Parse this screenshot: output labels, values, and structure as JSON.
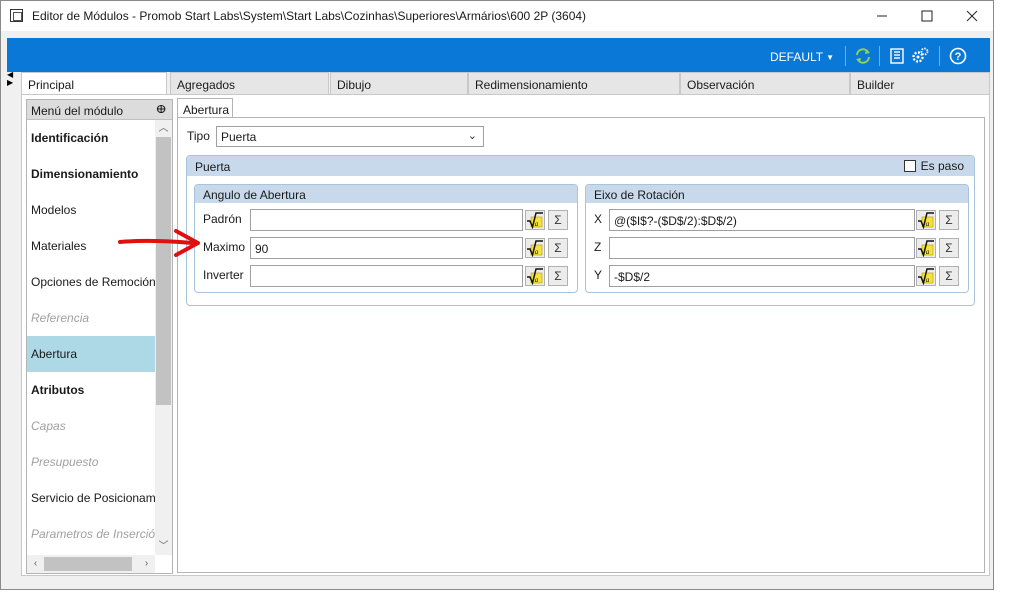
{
  "window": {
    "title": "Editor de Módulos - Promob Start Labs\\System\\Start Labs\\Cozinhas\\Superiores\\Armários\\600 2P (3604)"
  },
  "toolbar": {
    "profile_label": "DEFAULT",
    "icons": [
      "refresh-icon",
      "list-icon",
      "gears-icon",
      "help-icon"
    ],
    "accent_color": "#0a78d7"
  },
  "tabs": [
    {
      "label": "Principal",
      "active": true
    },
    {
      "label": "Agregados",
      "active": false
    },
    {
      "label": "Dibujo",
      "active": false
    },
    {
      "label": "Redimensionamiento",
      "active": false
    },
    {
      "label": "Observación",
      "active": false
    },
    {
      "label": "Builder",
      "active": false
    }
  ],
  "sidebar": {
    "header": "Menú del módulo",
    "items": [
      {
        "label": "Identificación",
        "style": "bold"
      },
      {
        "label": "Dimensionamiento",
        "style": "bold"
      },
      {
        "label": "Modelos",
        "style": "normal"
      },
      {
        "label": "Materiales",
        "style": "normal"
      },
      {
        "label": "Opciones de Remoción",
        "style": "normal"
      },
      {
        "label": "Referencia",
        "style": "muted"
      },
      {
        "label": "Abertura",
        "style": "selected"
      },
      {
        "label": "Atributos",
        "style": "bold"
      },
      {
        "label": "Capas",
        "style": "muted"
      },
      {
        "label": "Presupuesto",
        "style": "muted"
      },
      {
        "label": "Servicio de Posicionamie",
        "style": "normal"
      },
      {
        "label": "Parametros de Inserción",
        "style": "muted"
      }
    ]
  },
  "subtab": {
    "label": "Abertura"
  },
  "tipo": {
    "label": "Tipo",
    "value": "Puerta"
  },
  "puerta_group": {
    "title": "Puerta",
    "es_paso_label": "Es paso",
    "es_paso_checked": false,
    "angulo": {
      "title": "Angulo de Abertura",
      "fields": [
        {
          "label": "Padrón",
          "value": ""
        },
        {
          "label": "Maximo",
          "value": "90"
        },
        {
          "label": "Inverter",
          "value": ""
        }
      ]
    },
    "eixo": {
      "title": "Eixo de Rotación",
      "fields": [
        {
          "label": "X",
          "value": "@($I$?-($D$/2):$D$/2)"
        },
        {
          "label": "Z",
          "value": ""
        },
        {
          "label": "Y",
          "value": "-$D$/2"
        }
      ]
    }
  },
  "sigma_symbol": "Σ"
}
